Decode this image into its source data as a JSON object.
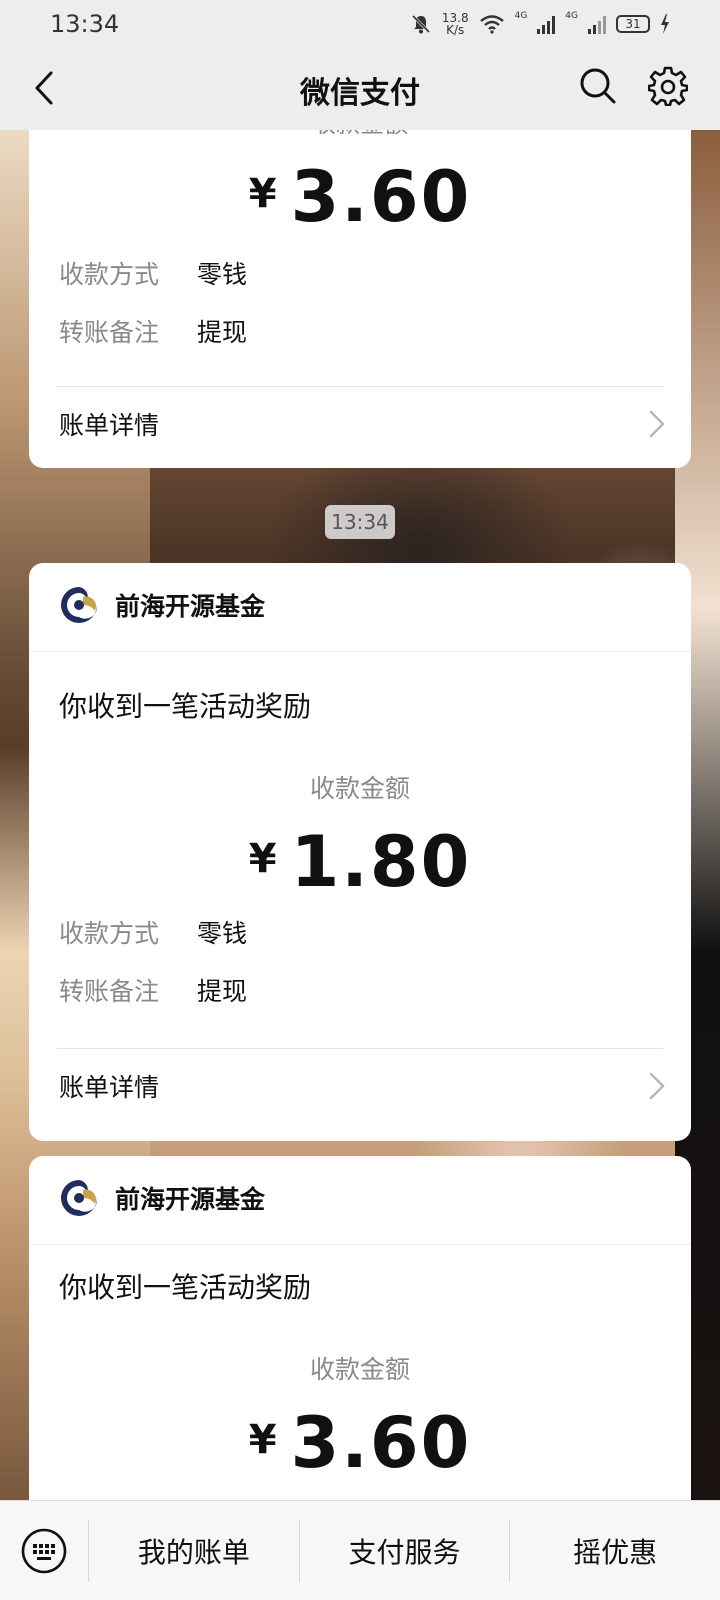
{
  "status_bar": {
    "time": "13:34",
    "net_speed_value": "13.8",
    "net_speed_unit": "K/s",
    "signal1_label": "4G",
    "signal2_label": "4G",
    "battery": "31"
  },
  "header": {
    "title": "微信支付",
    "icons": [
      "back-icon",
      "search-icon",
      "gear-icon"
    ]
  },
  "timestamp": "13:34",
  "cards": [
    {
      "partial_label": "收款金额",
      "currency": "¥",
      "amount": "3.60",
      "rows": [
        {
          "key": "收款方式",
          "value": "零钱"
        },
        {
          "key": "转账备注",
          "value": "提现"
        }
      ],
      "detail_label": "账单详情"
    },
    {
      "brand": "前海开源基金",
      "notice": "你收到一笔活动奖励",
      "amount_label": "收款金额",
      "currency": "¥",
      "amount": "1.80",
      "rows": [
        {
          "key": "收款方式",
          "value": "零钱"
        },
        {
          "key": "转账备注",
          "value": "提现"
        }
      ],
      "detail_label": "账单详情"
    },
    {
      "brand": "前海开源基金",
      "notice": "你收到一笔活动奖励",
      "amount_label": "收款金额",
      "currency": "¥",
      "amount": "3.60"
    }
  ],
  "bottom_menu": {
    "items": [
      "我的账单",
      "支付服务",
      "摇优惠"
    ]
  },
  "colors": {
    "bar_bg": "#ededed",
    "card_bg": "#ffffff",
    "muted_text": "#8a8a8a",
    "logo_navy": "#1f2e5c",
    "logo_gold": "#c9a24b"
  }
}
